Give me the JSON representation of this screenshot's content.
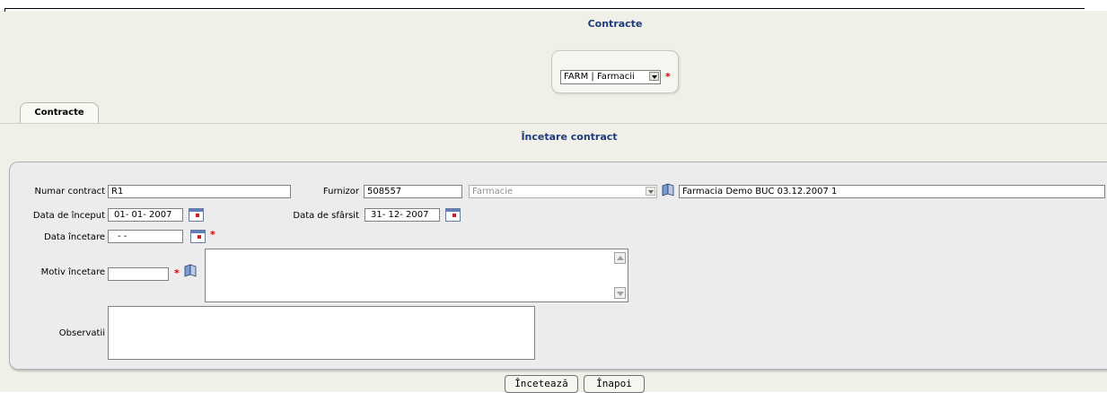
{
  "header": {
    "title": "Contracte"
  },
  "org_select": {
    "value": "FARM | Farmacii"
  },
  "tabs": [
    {
      "label": "Contracte"
    }
  ],
  "section": {
    "title": "Încetare contract"
  },
  "form": {
    "numar_contract": {
      "label": "Numar contract",
      "value": "R1"
    },
    "furnizor": {
      "label": "Furnizor",
      "code": "508557",
      "type": "Farmacie",
      "name": "Farmacia Demo BUC 03.12.2007 1"
    },
    "data_inceput": {
      "label": "Data de început",
      "value": "01- 01- 2007"
    },
    "data_sfarsit": {
      "label": "Data de sfârsit",
      "value": "31- 12- 2007"
    },
    "data_incetare": {
      "label": "Data încetare",
      "value": " -  - "
    },
    "motiv_incetare": {
      "label": "Motiv încetare",
      "value": ""
    },
    "observatii": {
      "label": "Observatii",
      "value": ""
    }
  },
  "buttons": {
    "inceteaza": "Încetează",
    "inapoi": "Înapoi"
  },
  "required_mark": "*",
  "colors": {
    "title": "#1f3a7a",
    "required": "#e00000",
    "panel": "#ececec"
  }
}
